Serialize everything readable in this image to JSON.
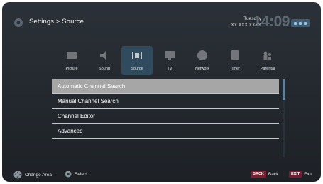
{
  "header": {
    "breadcrumb": "Settings > Source",
    "day": "Tuesday",
    "date": "XX XXX XXXX",
    "time": "14:09"
  },
  "tabs": [
    {
      "label": "Picture",
      "icon": "picture-icon",
      "active": false
    },
    {
      "label": "Sound",
      "icon": "speaker-icon",
      "active": false
    },
    {
      "label": "Source",
      "icon": "source-icon",
      "active": true
    },
    {
      "label": "TV",
      "icon": "tv-icon",
      "active": false
    },
    {
      "label": "Network",
      "icon": "globe-icon",
      "active": false
    },
    {
      "label": "Timer",
      "icon": "timer-icon",
      "active": false
    },
    {
      "label": "Parental",
      "icon": "parental-icon",
      "active": false
    }
  ],
  "menu": {
    "items": [
      {
        "label": "Automatic Channel Search",
        "selected": true
      },
      {
        "label": "Manual Channel Search",
        "selected": false
      },
      {
        "label": "Channel Editor",
        "selected": false
      },
      {
        "label": "Advanced",
        "selected": false
      }
    ]
  },
  "footer": {
    "change_area": "Change Area",
    "select": "Select",
    "back_key": "BACK",
    "back": "Back",
    "exit_key": "EXIT",
    "exit": "Exit"
  },
  "colors": {
    "background": "#23282e",
    "selected_row": "#a6a6a6",
    "active_tab": "#314b5e",
    "key_red": "#7a1f2f",
    "scroll_thumb": "#5f7f98"
  }
}
